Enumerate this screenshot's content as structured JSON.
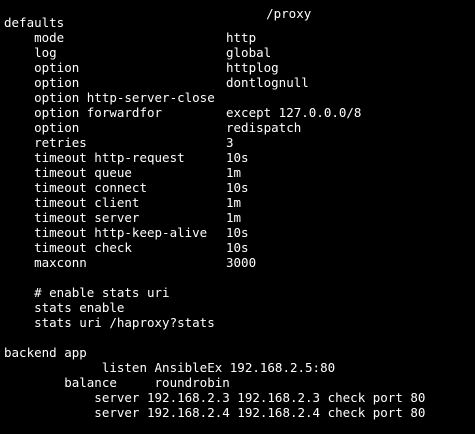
{
  "terminal": {
    "top_fragment": "/proxy",
    "lines": [
      {
        "a": "defaults",
        "b": ""
      },
      {
        "a": "    mode",
        "b": "http"
      },
      {
        "a": "    log",
        "b": "global"
      },
      {
        "a": "    option",
        "b": "httplog"
      },
      {
        "a": "    option",
        "b": "dontlognull"
      },
      {
        "a": "    option http-server-close",
        "b": ""
      },
      {
        "a": "    option forwardfor",
        "b": "except 127.0.0.0/8"
      },
      {
        "a": "    option",
        "b": "redispatch"
      },
      {
        "a": "    retries",
        "b": "3"
      },
      {
        "a": "    timeout http-request",
        "b": "10s"
      },
      {
        "a": "    timeout queue",
        "b": "1m"
      },
      {
        "a": "    timeout connect",
        "b": "10s"
      },
      {
        "a": "    timeout client",
        "b": "1m"
      },
      {
        "a": "    timeout server",
        "b": "1m"
      },
      {
        "a": "    timeout http-keep-alive",
        "b": "10s"
      },
      {
        "a": "    timeout check",
        "b": "10s"
      },
      {
        "a": "    maxconn",
        "b": "3000"
      },
      {
        "a": "",
        "b": ""
      },
      {
        "a": "    # enable stats uri",
        "b": ""
      },
      {
        "a": "    stats enable",
        "b": ""
      },
      {
        "a": "    stats uri /haproxy?stats",
        "b": ""
      },
      {
        "a": "",
        "b": ""
      },
      {
        "a": "backend app",
        "b": ""
      },
      {
        "a": "             listen AnsibleEx 192.168.2.5:80",
        "b": ""
      },
      {
        "a": "        balance     roundrobin",
        "b": ""
      },
      {
        "a": "            server 192.168.2.3 192.168.2.3 check port 80",
        "b": ""
      },
      {
        "a": "            server 192.168.2.4 192.168.2.4 check port 80",
        "b": ""
      }
    ]
  }
}
